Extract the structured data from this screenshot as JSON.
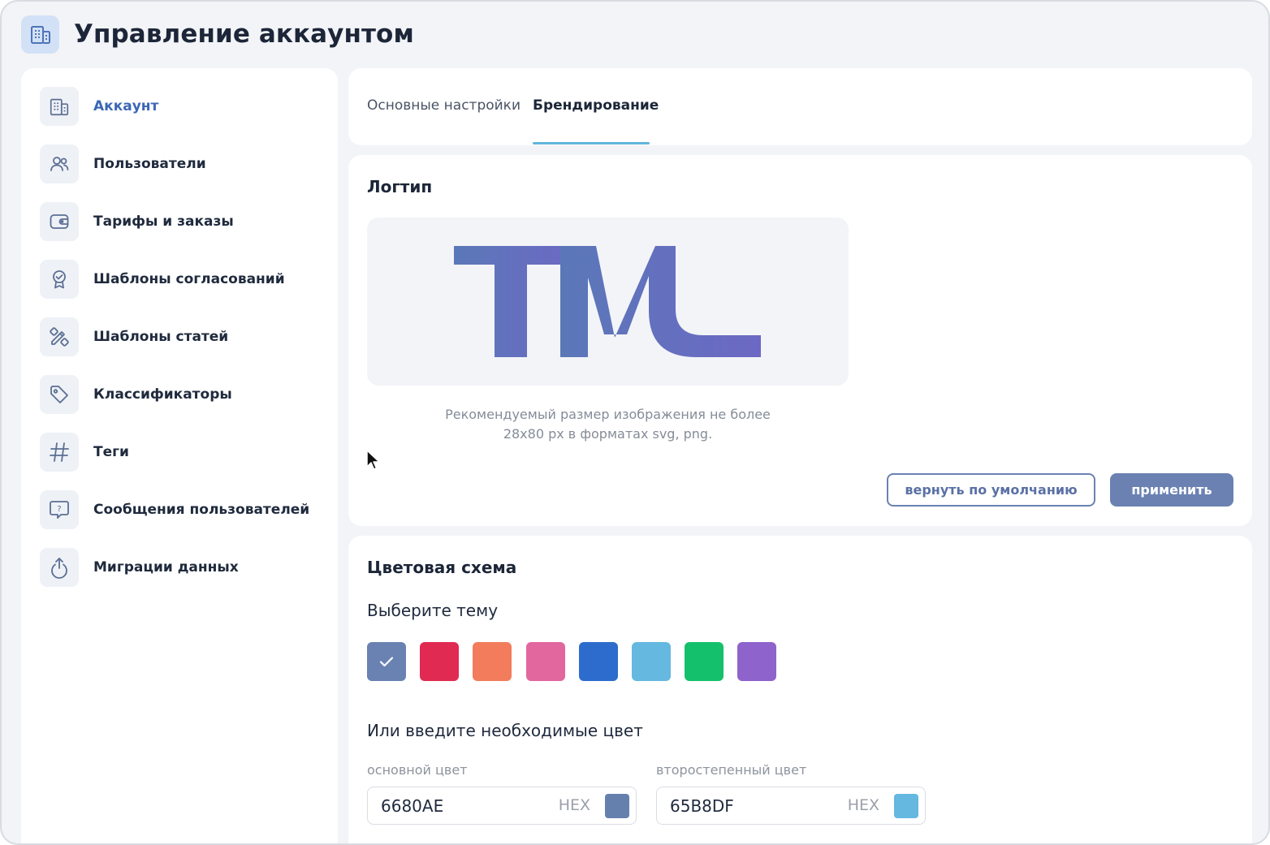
{
  "header": {
    "title": "Управление аккаунтом",
    "icon": "building-icon"
  },
  "sidebar": {
    "items": [
      {
        "label": "Аккаунт",
        "icon": "building-icon",
        "active": true
      },
      {
        "label": "Пользователи",
        "icon": "users-icon"
      },
      {
        "label": "Тарифы и заказы",
        "icon": "wallet-icon"
      },
      {
        "label": "Шаблоны согласований",
        "icon": "award-icon"
      },
      {
        "label": "Шаблоны статей",
        "icon": "tools-icon"
      },
      {
        "label": "Классификаторы",
        "icon": "tag-icon"
      },
      {
        "label": "Теги",
        "icon": "hash-icon"
      },
      {
        "label": "Сообщения пользователей",
        "icon": "message-question-icon"
      },
      {
        "label": "Миграции данных",
        "icon": "upload-icon"
      }
    ]
  },
  "tabs": {
    "main": "Основные настройки",
    "branding": "Брендирование",
    "active": "branding"
  },
  "logo_section": {
    "title": "Логтип",
    "hint_line1": "Рекомендуемый размер изображения не более",
    "hint_line2": "28x80 px в форматах svg, png.",
    "reset_button": "вернуть по умолчанию",
    "apply_button": "применить"
  },
  "color_section": {
    "title": "Цветовая схема",
    "theme_label": "Выберите тему",
    "themes": [
      "#6a82b2",
      "#e02a52",
      "#f27c5c",
      "#e2679f",
      "#2d6ccc",
      "#65b8df",
      "#15c06c",
      "#8e63cc"
    ],
    "selected_theme": 0,
    "custom_label": "Или введите необходимые цвет",
    "primary": {
      "label": "основной цвет",
      "value": "6680AE",
      "unit": "HEX",
      "color": "#6680ae"
    },
    "secondary": {
      "label": "второстепенный цвет",
      "value": "65B8DF",
      "unit": "HEX",
      "color": "#65b8df"
    }
  },
  "colors": {
    "accent": "#3b67b6",
    "tab_underline": "#61b5dc",
    "logo_start": "#5a78b8",
    "logo_end": "#6d68c4"
  }
}
